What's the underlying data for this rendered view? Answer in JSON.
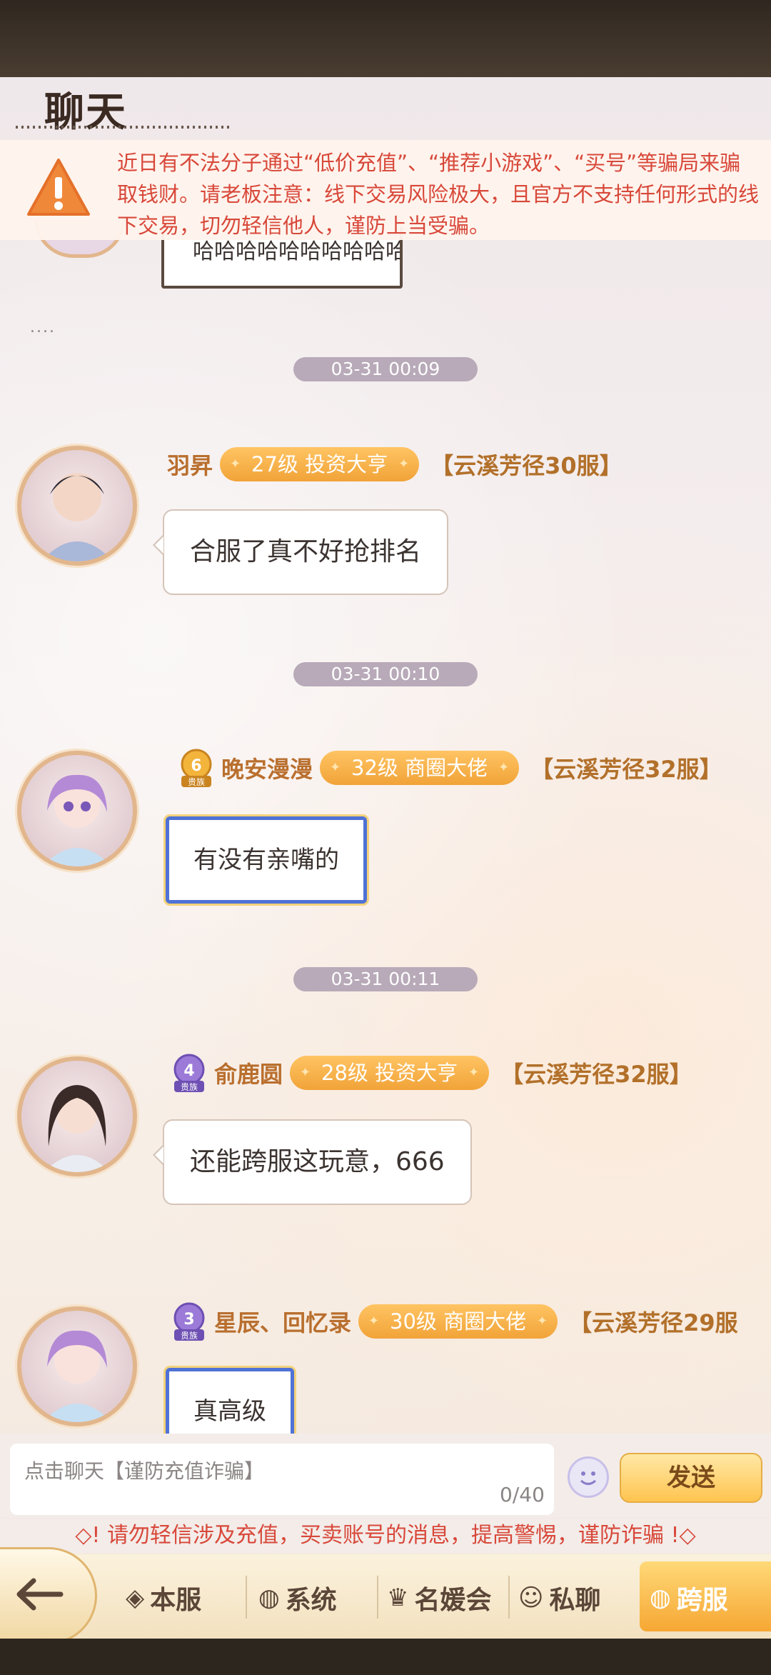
{
  "header": {
    "title": "聊天"
  },
  "warning": {
    "text": "近日有不法分子通过“低价充值”、“推荐小游戏”、“买号”等骗局来骗取钱财。请老板注意：线下交易风险极大，且官方不支持任何形式的线下交易，切勿轻信他人，谨防上当受骗。"
  },
  "partial_top": {
    "bubble_text": "哈哈哈哈哈哈哈哈哈哈",
    "ellipsis": "...."
  },
  "messages": [
    {
      "time": "03-31 00:09",
      "name": "羽昇",
      "vip": "",
      "level": "27级 投资大亨",
      "server": "【云溪芳径30服】",
      "text": "合服了真不好抢排名"
    },
    {
      "time": "03-31 00:10",
      "name": "晚安漫漫",
      "vip": "6",
      "vip_label": "贵族",
      "level": "32级 商圈大佬",
      "server": "【云溪芳径32服】",
      "text": "有没有亲嘴的"
    },
    {
      "time": "03-31 00:11",
      "name": "俞鹿圆",
      "vip": "4",
      "vip_label": "贵族",
      "level": "28级 投资大亨",
      "server": "【云溪芳径32服】",
      "text": "还能跨服这玩意，666"
    },
    {
      "time": "",
      "name": "星辰、回忆录",
      "vip": "3",
      "vip_label": "贵族",
      "level": "30级 商圈大佬",
      "server": "【云溪芳径29服",
      "text": "真高级"
    }
  ],
  "composer": {
    "placeholder": "点击聊天【谨防充值诈骗】",
    "counter": "0/40",
    "send_label": "发送"
  },
  "notice": {
    "text": "请勿轻信涉及充值，买卖账号的消息，提高警惕，谨防诈骗"
  },
  "tabs": [
    {
      "label": "本服",
      "icon": "diamond-icon"
    },
    {
      "label": "系统",
      "icon": "globe-icon"
    },
    {
      "label": "名媛会",
      "icon": "crown-icon"
    },
    {
      "label": "私聊",
      "icon": "chat-icon"
    },
    {
      "label": "跨服",
      "icon": "globe-icon",
      "active": true
    }
  ],
  "colors": {
    "accent": "#f1a338",
    "warning": "#d8483a",
    "name": "#b96f2e"
  }
}
